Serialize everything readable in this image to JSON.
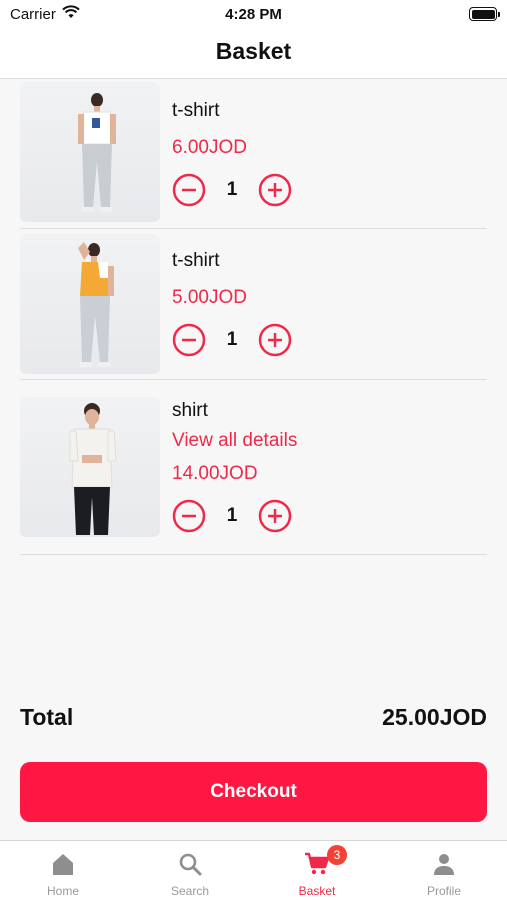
{
  "status_bar": {
    "carrier": "Carrier",
    "time": "4:28 PM"
  },
  "header": {
    "title": "Basket"
  },
  "items": [
    {
      "name": "t-shirt",
      "price": "6.00JOD",
      "quantity": "1"
    },
    {
      "name": "t-shirt",
      "price": "5.00JOD",
      "quantity": "1"
    },
    {
      "name": "shirt",
      "link": "View all details",
      "price": "14.00JOD",
      "quantity": "1"
    }
  ],
  "total": {
    "label": "Total",
    "value": "25.00JOD"
  },
  "checkout": {
    "label": "Checkout"
  },
  "tab_bar": {
    "tabs": [
      {
        "label": "Home",
        "icon": "home-icon"
      },
      {
        "label": "Search",
        "icon": "search-icon"
      },
      {
        "label": "Basket",
        "icon": "cart-icon",
        "badge": "3",
        "active": true
      },
      {
        "label": "Profile",
        "icon": "profile-icon"
      }
    ]
  },
  "colors": {
    "accent": "#f0284a",
    "checkout_bg": "#ff1744",
    "badge": "#f44336"
  }
}
